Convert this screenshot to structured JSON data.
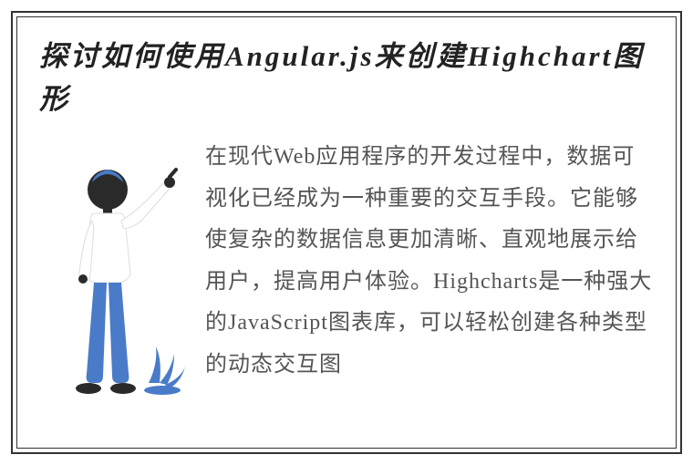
{
  "title": "探讨如何使用Angular.js来创建Highchart图形",
  "body": "在现代Web应用程序的开发过程中，数据可视化已经成为一种重要的交互手段。它能够使复杂的数据信息更加清晰、直观地展示给用户，提高用户体验。Highcharts是一种强大的JavaScript图表库，可以轻松创建各种类型的动态交互图"
}
